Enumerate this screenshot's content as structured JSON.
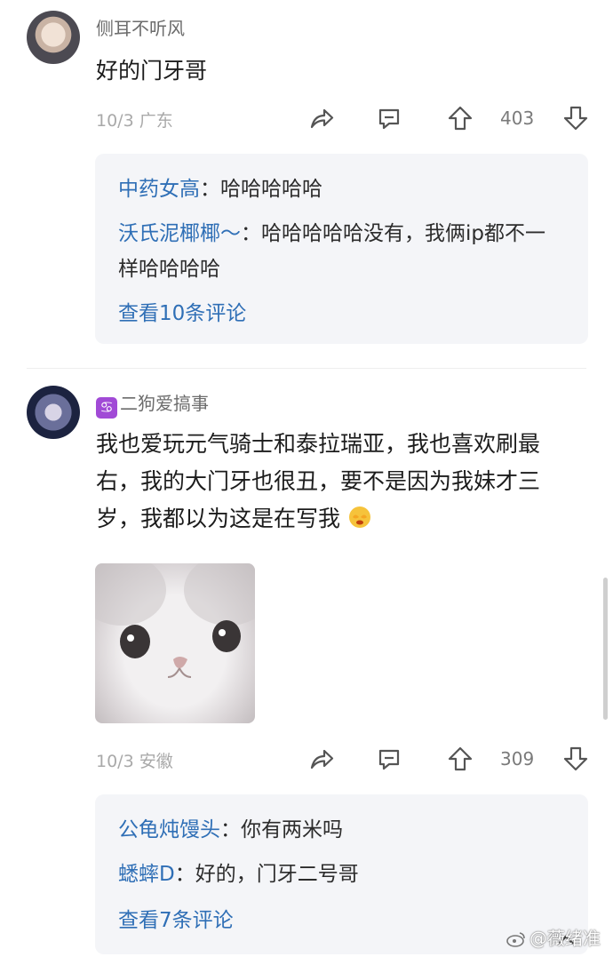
{
  "comments": [
    {
      "username": "侧耳不听风",
      "text": "好的门牙哥",
      "date": "10/3",
      "location": "广东",
      "upvotes": "403",
      "replies": [
        {
          "name": "中药女高",
          "sep": "：",
          "text": "哈哈哈哈哈"
        },
        {
          "name": "沃氏泥椰椰～",
          "sep": "：",
          "text": "哈哈哈哈哈没有，我俩ip都不一样哈哈哈哈"
        }
      ],
      "view_more": "查看10条评论"
    },
    {
      "badge": "♋",
      "username": "二狗爱搞事",
      "text": "我也爱玩元气骑士和泰拉瑞亚，我也喜欢刷最右，我的大门牙也很丑，要不是因为我妹才三岁，我都以为这是在写我",
      "date": "10/3",
      "location": "安徽",
      "upvotes": "309",
      "replies": [
        {
          "name": "公龟炖馒头",
          "sep": "：",
          "text": "你有两米吗"
        },
        {
          "name": "蟋蟀D",
          "sep": "：",
          "text": "好的，门牙二号哥"
        }
      ],
      "view_more": "查看7条评论"
    }
  ],
  "watermark": "@薇绪准",
  "colors": {
    "link": "#2f6fb6",
    "reply_bg": "#f4f5f8",
    "meta": "#a9a9a9"
  }
}
